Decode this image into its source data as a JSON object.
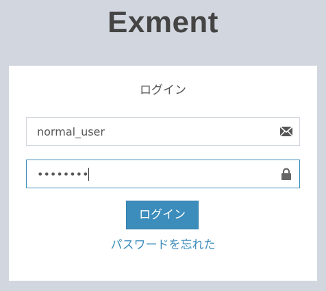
{
  "logo": {
    "text": "Exment"
  },
  "login": {
    "title": "ログイン",
    "username": {
      "value": "normal_user",
      "icon": "envelope-icon"
    },
    "password": {
      "value": "••••••••",
      "icon": "lock-icon"
    },
    "submit_label": "ログイン",
    "forgot_label": "パスワードを忘れた"
  },
  "colors": {
    "background": "#d2d6de",
    "primary": "#3c8dbc",
    "text": "#555555",
    "logo": "#444444"
  }
}
